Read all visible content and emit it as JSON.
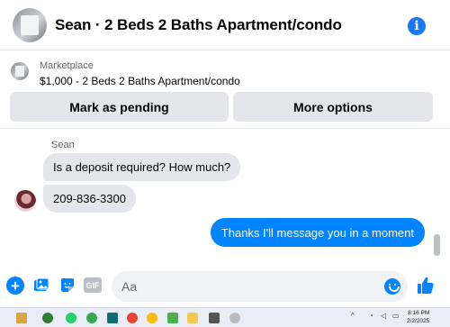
{
  "header": {
    "title": "Sean · 2 Beds 2 Baths Apartment/condo",
    "info_icon": "info-icon",
    "accent": "#1877f2"
  },
  "listing": {
    "label": "Marketplace",
    "title": "$1,000 - 2 Beds 2 Baths Apartment/condo",
    "buttons": {
      "pending": "Mark as pending",
      "more": "More options"
    }
  },
  "chat": {
    "sender": "Sean",
    "messages": [
      {
        "direction": "incoming",
        "text": "Is a deposit required? How much?"
      },
      {
        "direction": "incoming",
        "text": "209-836-3300"
      },
      {
        "direction": "outgoing",
        "text": "Thanks I'll message you in a moment"
      }
    ],
    "outgoing_color": "#0084ff",
    "incoming_color": "#e4e6eb"
  },
  "composer": {
    "placeholder": "Aa",
    "gif_label": "GIF",
    "icons": [
      "plus-icon",
      "photo-icon",
      "sticker-icon",
      "gif-icon",
      "emoji-icon",
      "like-icon"
    ]
  },
  "taskbar": {
    "time": "8:16 PM",
    "date": "2/2/2025"
  }
}
